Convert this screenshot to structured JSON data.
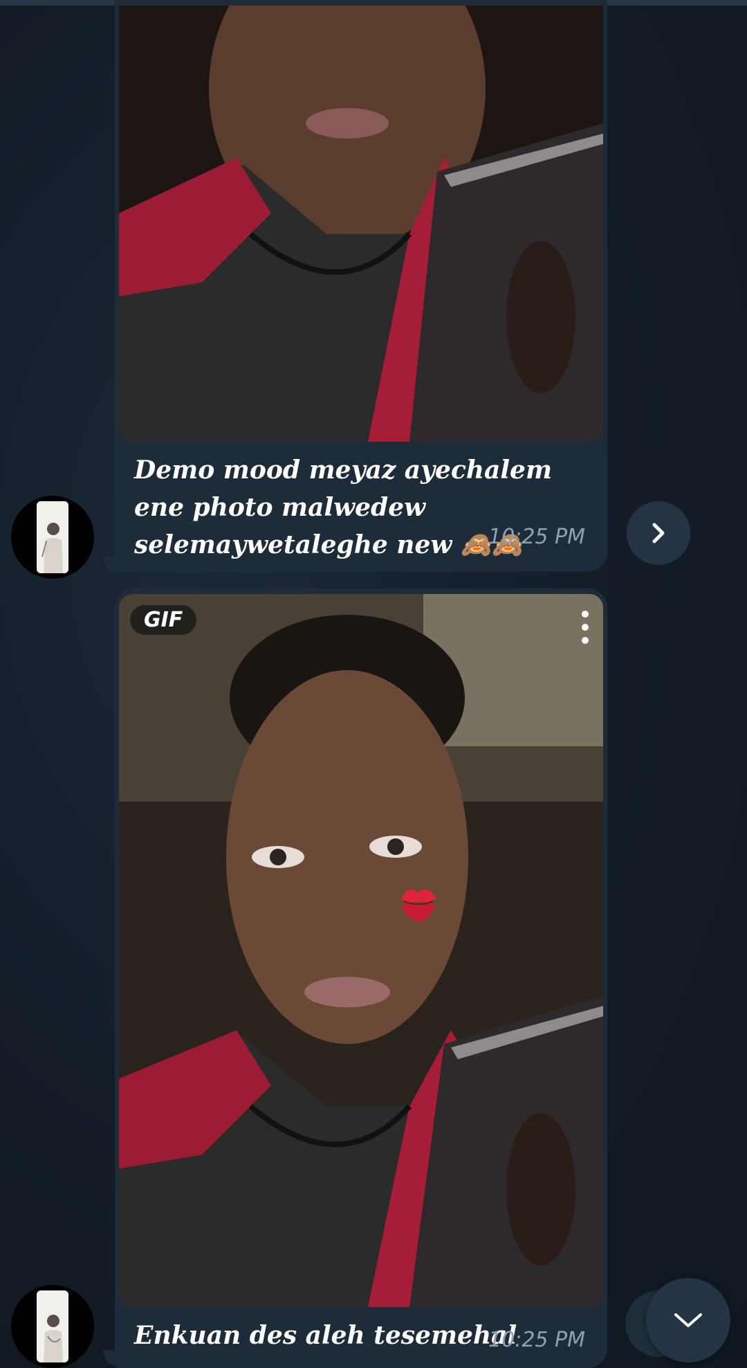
{
  "messages": [
    {
      "caption": "Demo mood meyaz ayechalem ene photo malwedew selemaywetaleghe new 🙈🙈",
      "time": "10:25 PM"
    },
    {
      "badge": "GIF",
      "caption": "Enkuan des aleh tesemehal",
      "time": "10:25 PM"
    }
  ],
  "colors": {
    "background": "#16202c",
    "bubble": "#1e2c3a",
    "time_text": "#8fa0b0",
    "button": "#253444"
  },
  "icons": {
    "share": "chevron-right-icon",
    "scroll_down": "chevron-down-icon",
    "more": "more-vertical-icon",
    "sticker": "kiss-mark-icon"
  }
}
